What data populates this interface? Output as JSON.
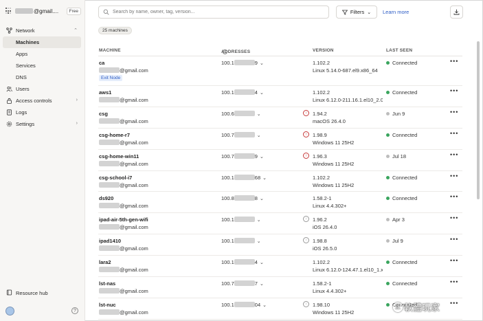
{
  "account": {
    "name_suffix": "@gmail....",
    "plan": "Free"
  },
  "nav": {
    "network": "Network",
    "items": [
      {
        "label": "Machines",
        "active": true
      },
      {
        "label": "Apps"
      },
      {
        "label": "Services"
      },
      {
        "label": "DNS"
      }
    ],
    "users": "Users",
    "access_controls": "Access controls",
    "logs": "Logs",
    "settings": "Settings",
    "resource_hub": "Resource hub"
  },
  "toolbar": {
    "search_placeholder": "Search by name, owner, tag, version...",
    "filters_label": "Filters",
    "learn_more": "Learn more"
  },
  "machine_count": "25 machines",
  "table": {
    "headers": {
      "machine": "MACHINE",
      "addresses": "ADDRESSES",
      "version": "VERSION",
      "last_seen": "LAST SEEN"
    },
    "rows": [
      {
        "name": "ca",
        "email": "@gmail.com",
        "tag": "Exit Node",
        "addr_prefix": "100.1",
        "addr_suffix": "9",
        "version": "1.102.2",
        "os": "Linux 5.14.0-687.el9.x86_64",
        "icon": "",
        "status": "Connected",
        "online": true
      },
      {
        "name": "aws1",
        "email": "@gmail.com",
        "addr_prefix": "100.1",
        "addr_suffix": "4",
        "version": "1.102.2",
        "os": "Linux 6.12.0-211.16.1.el10_2.0.1...",
        "icon": "",
        "status": "Connected",
        "online": true
      },
      {
        "name": "csg",
        "email": "@gmail.com",
        "addr_prefix": "100.6",
        "addr_suffix": "",
        "version": "1.94.2",
        "os": "macOS 26.4.0",
        "icon": "up",
        "status": "Jun 9",
        "online": false
      },
      {
        "name": "csg-home-r7",
        "email": "@gmail.com",
        "addr_prefix": "100.7",
        "addr_suffix": "",
        "version": "1.98.9",
        "os": "Windows 11 25H2",
        "icon": "up",
        "status": "Connected",
        "online": true
      },
      {
        "name": "csg-home-win11",
        "email": "@gmail.com",
        "addr_prefix": "100.7",
        "addr_suffix": "9",
        "version": "1.96.3",
        "os": "Windows 11 25H2",
        "icon": "up",
        "status": "Jul 18",
        "online": false
      },
      {
        "name": "csg-school-i7",
        "email": "@gmail.com",
        "addr_prefix": "100.1",
        "addr_suffix": "68",
        "version": "1.102.2",
        "os": "Windows 11 25H2",
        "icon": "",
        "status": "Connected",
        "online": true
      },
      {
        "name": "ds920",
        "email": "@gmail.com",
        "addr_prefix": "100.8",
        "addr_suffix": "8",
        "version": "1.58.2-1",
        "os": "Linux 4.4.302+",
        "icon": "",
        "status": "Connected",
        "online": true
      },
      {
        "name": "ipad-air-5th-gen-wifi",
        "email": "@gmail.com",
        "addr_prefix": "100.1",
        "addr_suffix": "",
        "version": "1.96.2",
        "os": "iOS 26.4.0",
        "icon": "info",
        "status": "Apr 3",
        "online": false
      },
      {
        "name": "ipad1410",
        "email": "@gmail.com",
        "addr_prefix": "100.1",
        "addr_suffix": "",
        "version": "1.98.8",
        "os": "iOS 26.5.0",
        "icon": "info",
        "status": "Jul 9",
        "online": false
      },
      {
        "name": "lara2",
        "email": "@gmail.com",
        "addr_prefix": "100.1",
        "addr_suffix": "4",
        "version": "1.102.2",
        "os": "Linux 6.12.0-124.47.1.el10_1.x8...",
        "icon": "",
        "status": "Connected",
        "online": true
      },
      {
        "name": "lst-nas",
        "email": "@gmail.com",
        "addr_prefix": "100.7",
        "addr_suffix": "7",
        "version": "1.58.2-1",
        "os": "Linux 4.4.302+",
        "icon": "",
        "status": "Connected",
        "online": true
      },
      {
        "name": "lst-nuc",
        "email": "@gmail.com",
        "addr_prefix": "100.1",
        "addr_suffix": "04",
        "version": "1.98.10",
        "os": "Windows 11 25H2",
        "icon": "info",
        "status": "Connected",
        "online": true
      }
    ]
  },
  "watermark": {
    "circle": "正",
    "text": "軟體玩家"
  }
}
